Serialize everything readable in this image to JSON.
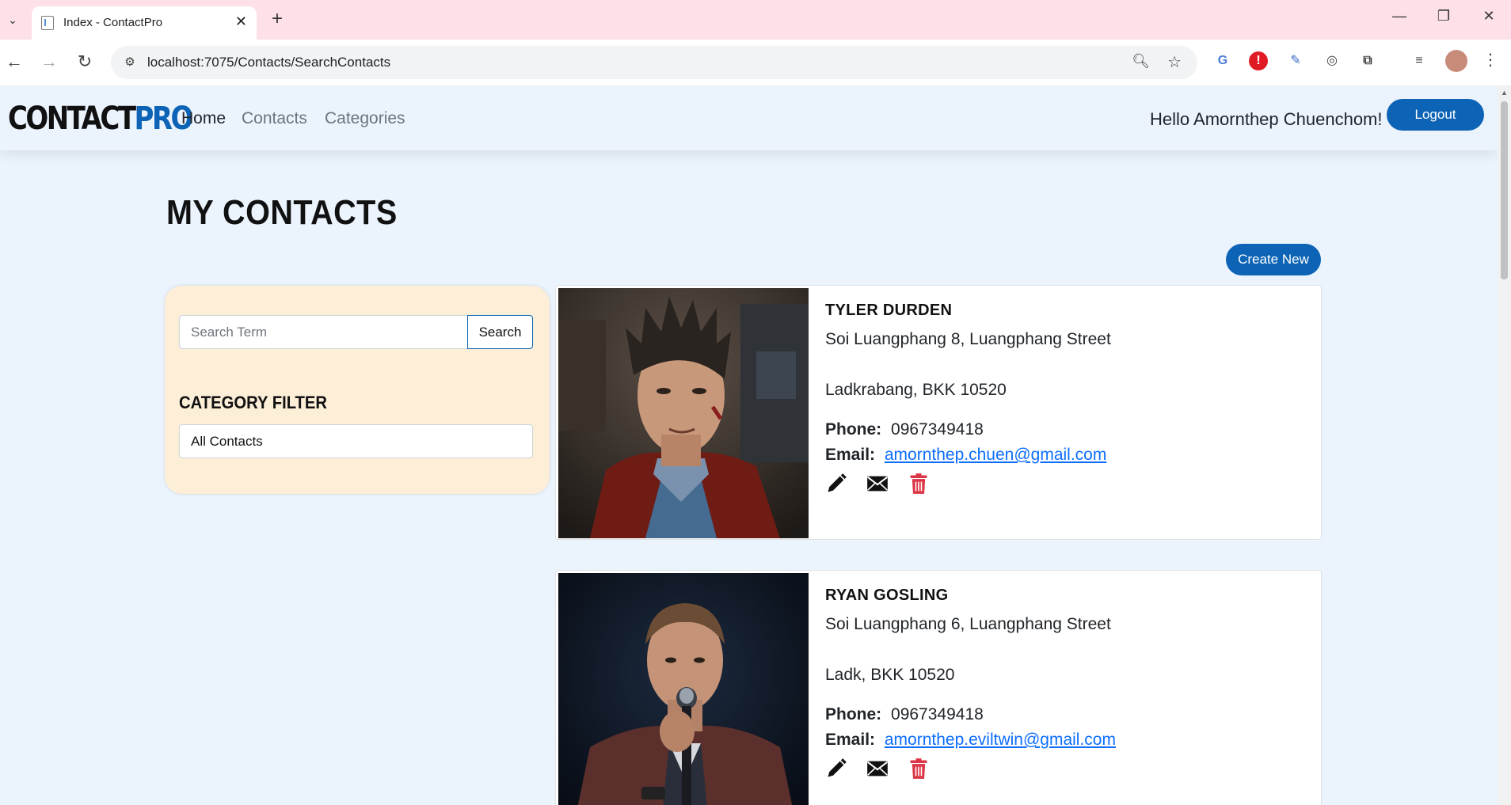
{
  "browser": {
    "tab_title": "Index - ContactPro",
    "url": "localhost:7075/Contacts/SearchContacts"
  },
  "navbar": {
    "brand_part1": "CONTACT",
    "brand_part2": "PRO",
    "links": [
      "Home",
      "Contacts",
      "Categories"
    ],
    "greeting": "Hello Amornthep Chuenchom!",
    "logout_label": "Logout"
  },
  "main": {
    "title": "MY CONTACTS",
    "create_label": "Create New"
  },
  "search": {
    "placeholder": "Search Term",
    "button_label": "Search",
    "category_label": "CATEGORY FILTER",
    "category_value": "All Contacts"
  },
  "contacts": [
    {
      "name": "TYLER DURDEN",
      "address1": "Soi Luangphang 8, Luangphang Street",
      "address2": "Ladkrabang, BKK 10520",
      "phone_label": "Phone:",
      "phone": "0967349418",
      "email_label": "Email:",
      "email": "amornthep.chuen@gmail.com"
    },
    {
      "name": "RYAN GOSLING",
      "address1": "Soi Luangphang 6, Luangphang Street",
      "address2": "Ladk, BKK 10520",
      "phone_label": "Phone:",
      "phone": "0967349418",
      "email_label": "Email:",
      "email": "amornthep.eviltwin@gmail.com"
    }
  ],
  "colors": {
    "primary": "#0d64b6",
    "page_bg": "#ebf3fd",
    "panel_bg": "#fdeed8",
    "delete": "#dc3545",
    "link": "#0d6efd"
  }
}
